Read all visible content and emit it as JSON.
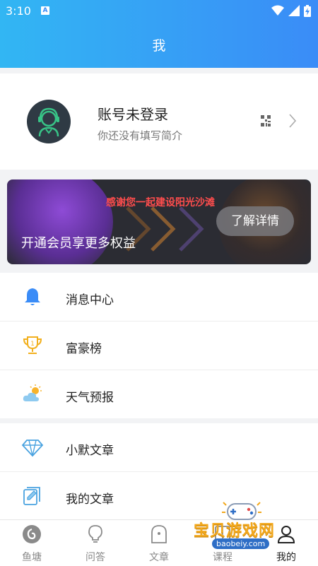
{
  "status_bar": {
    "time": "3:10",
    "notif_letter": "A"
  },
  "header": {
    "title": "我"
  },
  "profile": {
    "name": "账号未登录",
    "bio": "你还没有填写简介"
  },
  "banner": {
    "headline": "感谢您一起建设阳光沙滩",
    "text": "开通会员享更多权益",
    "button": "了解详情"
  },
  "menu_group1": [
    {
      "label": "消息中心",
      "icon": "bell-icon"
    },
    {
      "label": "富豪榜",
      "icon": "trophy-icon"
    },
    {
      "label": "天气预报",
      "icon": "weather-icon"
    }
  ],
  "menu_group2": [
    {
      "label": "小默文章",
      "icon": "diamond-icon"
    },
    {
      "label": "我的文章",
      "icon": "edit-document-icon"
    }
  ],
  "tabs": [
    {
      "label": "鱼塘",
      "icon": "fish-pond-icon"
    },
    {
      "label": "问答",
      "icon": "lightbulb-icon"
    },
    {
      "label": "文章",
      "icon": "article-icon"
    },
    {
      "label": "课程",
      "icon": "course-icon"
    },
    {
      "label": "我的",
      "icon": "user-icon",
      "active": true
    }
  ],
  "watermark": {
    "text": "宝贝游戏网",
    "url": "baobeiy.com"
  },
  "colors": {
    "header_start": "#32b6f3",
    "header_end": "#3a8cf7",
    "banner_bg": "#2b2c33",
    "banner_headline": "#ff4d4d",
    "bell": "#3a8cf7",
    "trophy": "#f2b01e"
  }
}
